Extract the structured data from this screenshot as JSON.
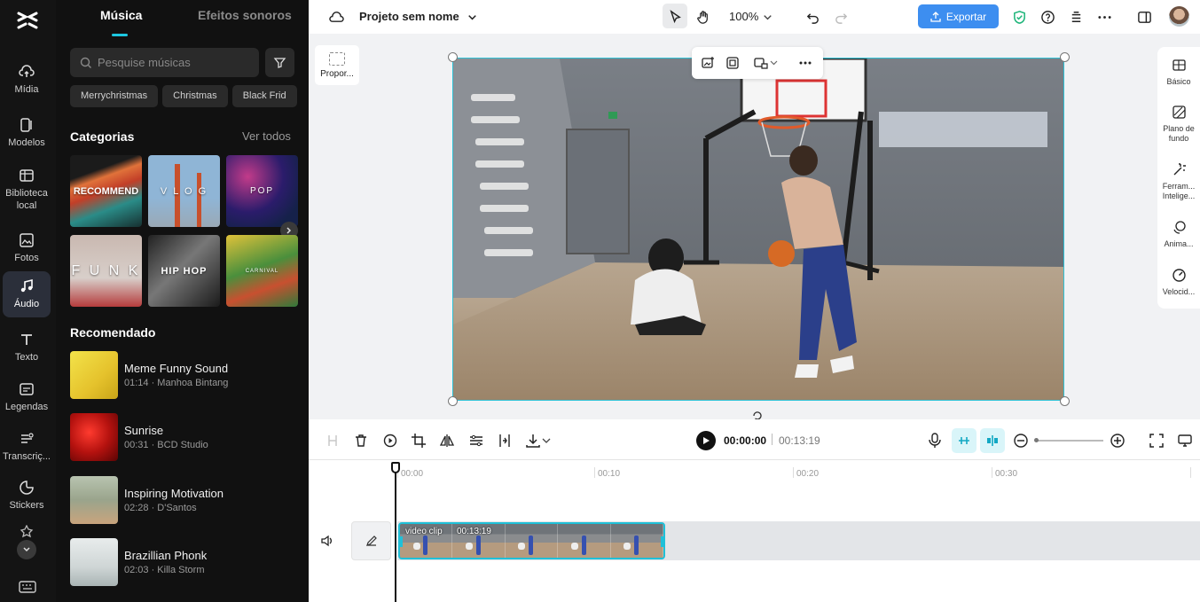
{
  "rail": {
    "items": [
      {
        "label": "Mídia",
        "icon": "cloud-upload-icon"
      },
      {
        "label": "Modelos",
        "icon": "templates-icon"
      },
      {
        "label": "Biblioteca local",
        "icon": "library-icon"
      },
      {
        "label": "Fotos",
        "icon": "photo-icon"
      },
      {
        "label": "Áudio",
        "icon": "music-note-icon",
        "active": true
      },
      {
        "label": "Texto",
        "icon": "text-icon"
      },
      {
        "label": "Legendas",
        "icon": "captions-icon"
      },
      {
        "label": "Transcriç...",
        "icon": "transcript-icon"
      },
      {
        "label": "Stickers",
        "icon": "sticker-icon"
      }
    ]
  },
  "panel": {
    "tabs": [
      "Música",
      "Efeitos sonoros"
    ],
    "search_placeholder": "Pesquise músicas",
    "chips": [
      "Merrychristmas",
      "Christmas",
      "Black Frid"
    ],
    "categories_title": "Categorias",
    "see_all": "Ver todos",
    "categories": [
      "RECOMMEND",
      "V L O G",
      "POP",
      "F U N K",
      "HIP HOP",
      "CARNIVAL"
    ],
    "recommended_title": "Recomendado",
    "tracks": [
      {
        "name": "Meme Funny Sound",
        "meta": "01:14 · Manhoa Bintang"
      },
      {
        "name": "Sunrise",
        "meta": "00:31 · BCD Studio"
      },
      {
        "name": "Inspiring Motivation",
        "meta": "02:28 · D'Santos"
      },
      {
        "name": "Brazillian Phonk",
        "meta": "02:03 · Killa Storm"
      }
    ]
  },
  "topbar": {
    "project_name": "Projeto sem nome",
    "zoom": "100%",
    "export_label": "Exportar"
  },
  "canvas": {
    "ratio_label": "Propor..."
  },
  "right_panel": {
    "items": [
      "Básico",
      "Plano de fundo",
      "Ferram... Intelige...",
      "Anima...",
      "Velocid..."
    ]
  },
  "timeline": {
    "current_time": "00:00:00",
    "total_time": "00:13:19",
    "ruler": [
      "00:00",
      "00:10",
      "00:20",
      "00:30"
    ],
    "clip_title": "video clip",
    "clip_duration": "00:13:19"
  },
  "colors": {
    "accent": "#1fc0d8",
    "export": "#3d8ef0"
  }
}
